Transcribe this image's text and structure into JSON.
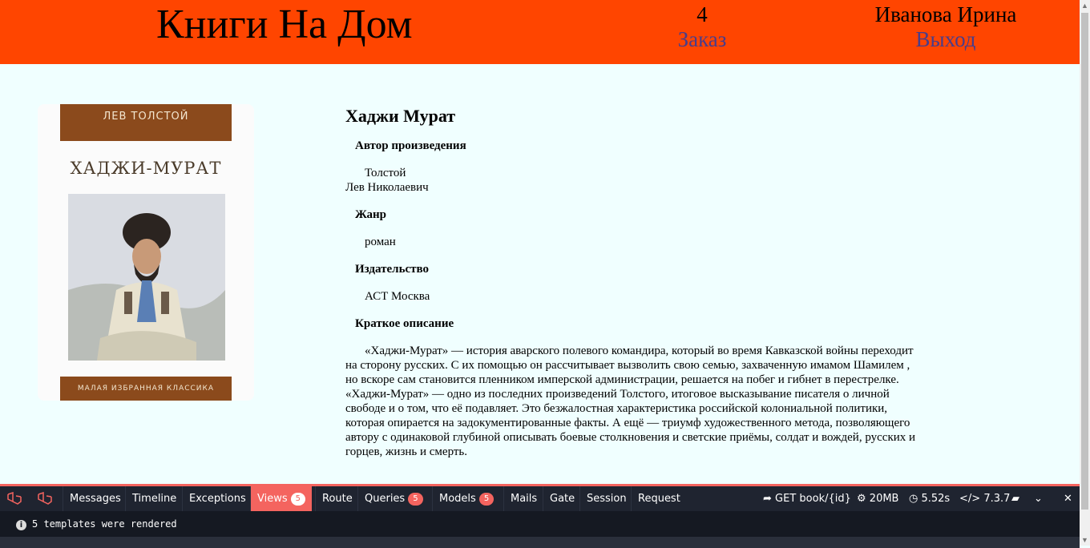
{
  "header": {
    "site_title": "Книги На Дом",
    "cart_count": "4",
    "cart_link": "Заказ",
    "user_name": "Иванова Ирина",
    "logout_link": "Выход"
  },
  "cover": {
    "author": "ЛЕВ ТОЛСТОЙ",
    "title": "ХАДЖИ-МУРАТ",
    "series": "МАЛАЯ ИЗБРАННАЯ КЛАССИКА"
  },
  "book": {
    "title": "Хаджи Мурат",
    "author_label": "Автор произведения",
    "author_line1": "Толстой",
    "author_line2": "Лев Николаевич",
    "genre_label": "Жанр",
    "genre": "роман",
    "publisher_label": "Издательство",
    "publisher": "АСТ Москва",
    "description_label": "Краткое описание",
    "description": "«Хаджи-Мурат» — история аварского полевого командира, который во время Кавказской войны переходит на сторону русских. С их помощью он рассчитывает вызволить свою семью, захваченную имамом Шамилем , но вскоре сам становится пленником имперской администрации, решается на побег и гибнет в перестрелке. «Хаджи-Мурат» — одно из последних произведений Толстого, итоговое высказывание писателя о личной свободе и о том, что её подавляет. Это безжалостная характеристика российской колониальной политики, которая опирается на задокументированные факты. А ещё — триумф художественного метода, позволяющего автору с одинаковой глубиной описывать боевые столкновения и светские приёмы, солдат и вождей, русских и горцев, жизнь и смерть."
  },
  "debugbar": {
    "tabs": [
      {
        "label": "Messages"
      },
      {
        "label": "Timeline"
      },
      {
        "label": "Exceptions"
      },
      {
        "label": "Views",
        "badge": "5"
      },
      {
        "label": "Route"
      },
      {
        "label": "Queries",
        "badge": "5"
      },
      {
        "label": "Models",
        "badge": "5"
      },
      {
        "label": "Mails"
      },
      {
        "label": "Gate"
      },
      {
        "label": "Session"
      },
      {
        "label": "Request"
      }
    ],
    "route": "GET book/{id}",
    "memory": "20MB",
    "time": "5.52s",
    "php_version": "7.3.7",
    "message": "5 templates were rendered",
    "accent_color": "#f4645f"
  },
  "colors": {
    "header_bg": "#ff4500",
    "page_bg": "#f0ffff",
    "link": "#483d8b"
  }
}
